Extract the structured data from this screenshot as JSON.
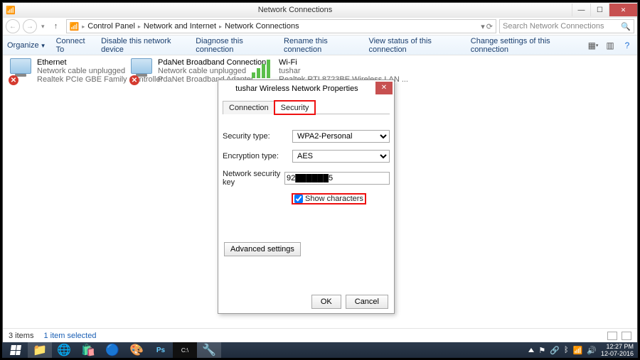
{
  "window": {
    "title": "Network Connections",
    "breadcrumb": [
      "Control Panel",
      "Network and Internet",
      "Network Connections"
    ],
    "search_placeholder": "Search Network Connections"
  },
  "toolbar": {
    "organize": "Organize",
    "items": [
      "Connect To",
      "Disable this network device",
      "Diagnose this connection",
      "Rename this connection",
      "View status of this connection",
      "Change settings of this connection"
    ]
  },
  "connections": [
    {
      "name": "Ethernet",
      "status": "Network cable unplugged",
      "adapter": "Realtek PCIe GBE Family Controller",
      "icon": "nic-x"
    },
    {
      "name": "PdaNet Broadband Connection",
      "status": "Network cable unplugged",
      "adapter": "PdaNet Broadband Adapter",
      "icon": "nic-x"
    },
    {
      "name": "Wi-Fi",
      "status": "tushar",
      "adapter": "Realtek RTL8723BE Wireless LAN ...",
      "icon": "wifi"
    }
  ],
  "statusbar": {
    "items": "3 items",
    "selected": "1 item selected"
  },
  "dialog": {
    "title": "tushar Wireless Network Properties",
    "tabs": [
      "Connection",
      "Security"
    ],
    "active_tab": 1,
    "fields": {
      "security_type": {
        "label": "Security type:",
        "value": "WPA2-Personal"
      },
      "encryption": {
        "label": "Encryption type:",
        "value": "AES"
      },
      "key": {
        "label": "Network security key",
        "value": "92██████5"
      },
      "show_chars": {
        "label": "Show characters",
        "checked": true
      }
    },
    "advanced": "Advanced settings",
    "ok": "OK",
    "cancel": "Cancel"
  },
  "tray": {
    "time": "12:27 PM",
    "date": "12-07-2016"
  }
}
